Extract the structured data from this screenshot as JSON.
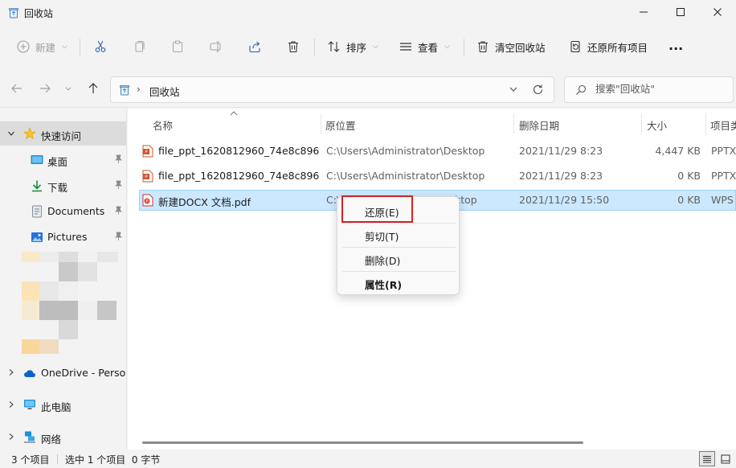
{
  "window": {
    "title": "回收站"
  },
  "toolbar": {
    "new_label": "新建",
    "sort_label": "排序",
    "view_label": "查看",
    "empty_recycle_label": "清空回收站",
    "restore_all_label": "还原所有项目",
    "more_label": "..."
  },
  "address": {
    "crumb_separator": "›",
    "crumb": "回收站"
  },
  "search": {
    "placeholder": "搜索\"回收站\""
  },
  "sidebar": {
    "quick_access": "快速访问",
    "pinned": [
      {
        "label": "桌面",
        "icon": "desktop-icon"
      },
      {
        "label": "下载",
        "icon": "download-icon"
      },
      {
        "label": "Documents",
        "icon": "documents-icon"
      },
      {
        "label": "Pictures",
        "icon": "pictures-icon"
      }
    ],
    "onedrive": "OneDrive - Persor",
    "this_pc": "此电脑",
    "network": "网络"
  },
  "columns": {
    "name": "名称",
    "original_location": "原位置",
    "date_deleted": "删除日期",
    "size": "大小",
    "item_type": "项目类"
  },
  "files": [
    {
      "name": "file_ppt_1620812960_74e8c896d...",
      "location": "C:\\Users\\Administrator\\Desktop",
      "date": "2021/11/29 8:23",
      "size": "4,447 KB",
      "type": "PPTX",
      "icon": "pptx-file-icon"
    },
    {
      "name": "file_ppt_1620812960_74e8c896d...",
      "location": "C:\\Users\\Administrator\\Desktop",
      "date": "2021/11/29 8:23",
      "size": "0 KB",
      "type": "PPTX",
      "icon": "pptx-file-icon"
    },
    {
      "name": "新建DOCX 文档.pdf",
      "location": "C:\\Users\\Administrator\\Desktop",
      "date": "2021/11/29 15:50",
      "size": "0 KB",
      "type": "WPS",
      "icon": "pdf-file-icon"
    }
  ],
  "selected_file": {
    "location_left": "C:\\",
    "location_right": "ktop"
  },
  "context_menu": {
    "restore": "还原(E)",
    "cut": "剪切(T)",
    "delete": "删除(D)",
    "properties": "属性(R)"
  },
  "status": {
    "item_count": "3 个项目",
    "selection": "选中 1 个项目  0 字节"
  },
  "colors": {
    "selection_bg": "#cce8ff",
    "selection_border": "#99d1ff",
    "highlight_box": "#d32222",
    "accent": "#0067c0"
  }
}
